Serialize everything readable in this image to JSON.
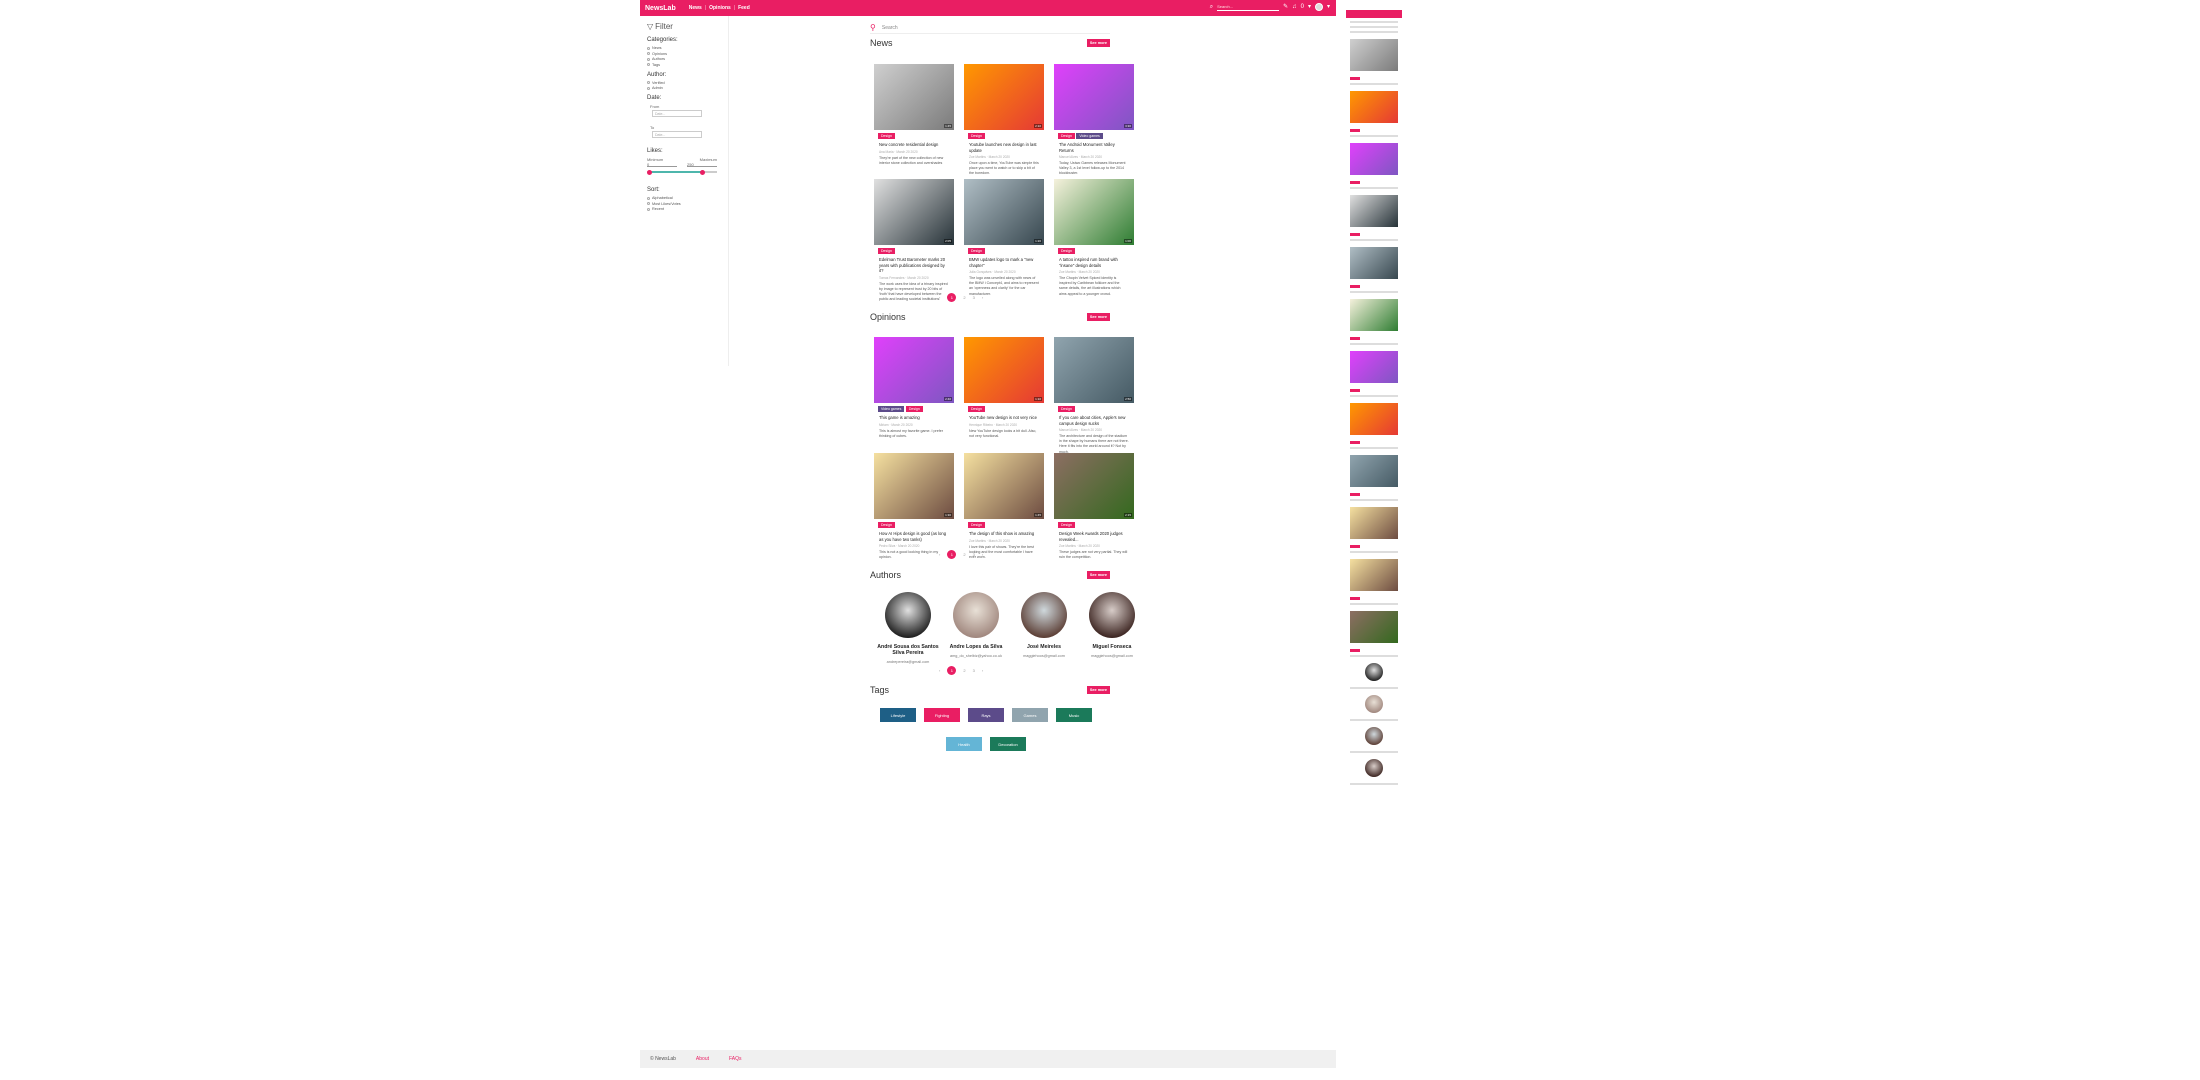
{
  "nav": {
    "brand": "NewsLab",
    "links": [
      "News",
      "Opinions",
      "Feed"
    ],
    "search_placeholder": "Search...",
    "notif_count": "0"
  },
  "sidebar": {
    "title": "Filter",
    "categories_title": "Categories:",
    "categories": [
      "News",
      "Opinions",
      "Authors",
      "Tags"
    ],
    "author_title": "Author:",
    "author_options": [
      "Verified",
      "Admin"
    ],
    "date_title": "Date:",
    "from_label": "From",
    "from_placeholder": "Date...",
    "to_label": "To",
    "to_placeholder": "Date...",
    "likes_title": "Likes:",
    "min_label": "Minimum",
    "max_label": "Maximum",
    "min_value": "0",
    "max_value": "250",
    "min_fraction": 0.0,
    "max_fraction": 0.8,
    "sort_title": "Sort:",
    "sort_options": [
      "Alphabetical",
      "Most Likes/Votes",
      "Recent"
    ]
  },
  "main": {
    "search_placeholder": "Search",
    "see_more": "See more",
    "news_title": "News",
    "opinions_title": "Opinions",
    "authors_title": "Authors",
    "tags_title": "Tags",
    "pager": {
      "prev": "‹",
      "pages": [
        "1",
        "2",
        "3"
      ],
      "next": "›"
    },
    "news": [
      {
        "tags": [
          "Design"
        ],
        "title": "New concrete residential design",
        "meta": "Ana Maria · March 20 2020",
        "body": "They're part of the new collection of new interior stone collection and overshades",
        "dur": "1:45",
        "img": "sneaker",
        "colors": [
          "#cfcfcf",
          "#7b7b7b"
        ]
      },
      {
        "tags": [
          "Design"
        ],
        "title": "Youtube launches new design in last update",
        "meta": "Zoe Martins · March 20 2020",
        "body": "Once upon a time, YouTube was simple this place you went to watch or to skip a bit of the boredom.",
        "dur": "2:10",
        "img": "phone",
        "colors": [
          "#ff9800",
          "#e53935"
        ]
      },
      {
        "tags": [
          "Design",
          "Video games"
        ],
        "title": "The Android Monument Valley Returns",
        "meta": "Manuel Alves · March 20 2020",
        "body": "Today, Ustwo Games releases Monument Valley 3, a 1st level follow-up to the 2014 blockbuster.",
        "dur": "3:30",
        "img": "castle",
        "colors": [
          "#e040fb",
          "#7e57c2"
        ]
      },
      {
        "tags": [
          "Design"
        ],
        "title": "Edelman Trust Barometer marks 20 years with publications designed by it?",
        "meta": "Tomas Fernandes · March 20 2020",
        "body": "The work uses the idea of a trinary inspired by image to represent trust by 20 bits of 'truth' that have developed between the public and leading societal institutions.",
        "dur": "2:05",
        "img": "logo",
        "colors": [
          "#e0e0e0",
          "#263238"
        ]
      },
      {
        "tags": [
          "Design"
        ],
        "title": "BMW updates logo to mark a \"new chapter\"",
        "meta": "Julia Gonçalves · March 20 2020",
        "body": "The logo was unveiled along with news of the BMW i Concept4, and aims to represent an 'openness and clarity' for the car manufacturer.",
        "dur": "1:20",
        "img": "bmw",
        "colors": [
          "#b0bec5",
          "#37474f"
        ]
      },
      {
        "tags": [
          "Design"
        ],
        "title": "A tattoo inspired rum brand with \"insane\" design details",
        "meta": "Zoe Martins · March 20 2020",
        "body": "The Chopin Velvet Spiced identity is inspired by Caribbean folklore and the same details, the art illustrations which aims appeal to a younger crowd.",
        "dur": "1:00",
        "img": "bottle",
        "colors": [
          "#f5f1dc",
          "#2e7d32"
        ]
      }
    ],
    "opinions": [
      {
        "tags": [
          "Video games",
          "Design"
        ],
        "title": "This game is amazing",
        "meta": "Miriam · March 20 2020",
        "body": "This is almost my favorite game. I prefer thinking of cubes.",
        "dur": "2:40",
        "img": "castle",
        "colors": [
          "#e040fb",
          "#7e57c2"
        ]
      },
      {
        "tags": [
          "Design"
        ],
        "title": "YouTube new design is not very nice",
        "meta": "Henrique Ribeiro · March 20 2020",
        "body": "New YouTube design looks a bit dull. Also, not very functional.",
        "dur": "1:10",
        "img": "phone",
        "colors": [
          "#ff9800",
          "#e53935"
        ]
      },
      {
        "tags": [
          "Design"
        ],
        "title": "If you care about cities, Apple's new campus design sucks",
        "meta": "Manuel Alves · March 20 2020",
        "body": "The architecture and design of the stadium in the shape by humans there are not there. Here it fits into the world around it? Not by much.",
        "dur": "2:50",
        "img": "campus",
        "colors": [
          "#90a4ae",
          "#455a64"
        ]
      },
      {
        "tags": [
          "Design"
        ],
        "title": "How AI Hips design is good (as long as you have two tanks)",
        "meta": "Pedro Silva · March 20 2020",
        "body": "This is not a good looking thing in my opinion.",
        "dur": "1:30",
        "img": "woman",
        "colors": [
          "#f5e0a0",
          "#6d4c41"
        ]
      },
      {
        "tags": [
          "Design"
        ],
        "title": "The design of this show is amazing",
        "meta": "Zoe Martins · March 20 2020",
        "body": "I love this pair of shows. They're the best looking and the most comfortable I have ever worn.",
        "dur": "1:45",
        "img": "woman",
        "colors": [
          "#f5e0a0",
          "#6d4c41"
        ]
      },
      {
        "tags": [
          "Design"
        ],
        "title": "Design Week Awards 2020 judges revealed...",
        "meta": "Zoe Martins · March 20 2020",
        "body": "These judges are not very partial. They will ruin the competition.",
        "dur": "2:15",
        "img": "group",
        "colors": [
          "#8d6e63",
          "#33691e"
        ]
      }
    ],
    "authors": [
      {
        "name": "André Sousa dos Santos Silva Pereira",
        "email": "andrepereira@gmail.com",
        "colors": [
          "#e0e0e0",
          "#212121"
        ]
      },
      {
        "name": "Andre Lopes da Silva",
        "email": "amg_do_shelbiz@yahoo.co.uk",
        "colors": [
          "#e8e0d6",
          "#a1887f"
        ]
      },
      {
        "name": "José Meireles",
        "email": "maggiehoos@gmail.com",
        "colors": [
          "#cfd8dc",
          "#5d4037"
        ]
      },
      {
        "name": "Miguel Fonseca",
        "email": "maggiehoos@gmail.com",
        "colors": [
          "#d7ccc8",
          "#3e2723"
        ]
      }
    ],
    "tags": [
      {
        "label": "Lifestyle",
        "color": "#1e5f86"
      },
      {
        "label": "Fighting",
        "color": "#e91e63"
      },
      {
        "label": "Rays",
        "color": "#5c4b8a"
      },
      {
        "label": "Games",
        "color": "#90a4ae"
      },
      {
        "label": "Music",
        "color": "#1b7a5a"
      },
      {
        "label": "Health",
        "color": "#64b5d6"
      },
      {
        "label": "Decoration",
        "color": "#1b7a5a"
      }
    ]
  },
  "footer": {
    "copyright": "© NewsLab",
    "links": [
      "About",
      "FAQs"
    ]
  },
  "colors": {
    "accent": "#e91e63",
    "teal": "#4db6ac"
  }
}
